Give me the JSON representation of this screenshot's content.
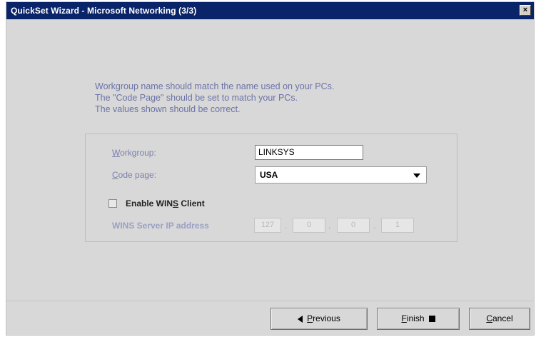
{
  "window": {
    "title": "QuickSet Wizard - Microsoft Networking (3/3)",
    "close_label": "×"
  },
  "intro_lines": [
    "Workgroup name should match the name used on your PCs.",
    "The \"Code Page\" should be set to match your PCs.",
    "The values shown should be correct."
  ],
  "form": {
    "workgroup_label_prefix": "",
    "workgroup_label_u": "W",
    "workgroup_label_rest": "orkgroup:",
    "workgroup_value": "LINKSYS",
    "codepage_label_u": "C",
    "codepage_label_rest": "ode page:",
    "codepage_value": "USA",
    "wins_checkbox_checked": false,
    "wins_label_prefix": "Enable WIN",
    "wins_label_u": "S",
    "wins_label_rest": " Client",
    "wins_server_label": "WINS Server IP address",
    "wins_ip": [
      "127",
      "0",
      "0",
      "1"
    ]
  },
  "buttons": {
    "previous_u": "P",
    "previous_rest": "revious",
    "finish_u": "F",
    "finish_rest": "inish",
    "cancel_u": "C",
    "cancel_rest": "ancel"
  },
  "colors": {
    "titlebar": "#0a2469",
    "intro_text": "#6b73a8",
    "dialog_bg": "#d8d8d8"
  }
}
